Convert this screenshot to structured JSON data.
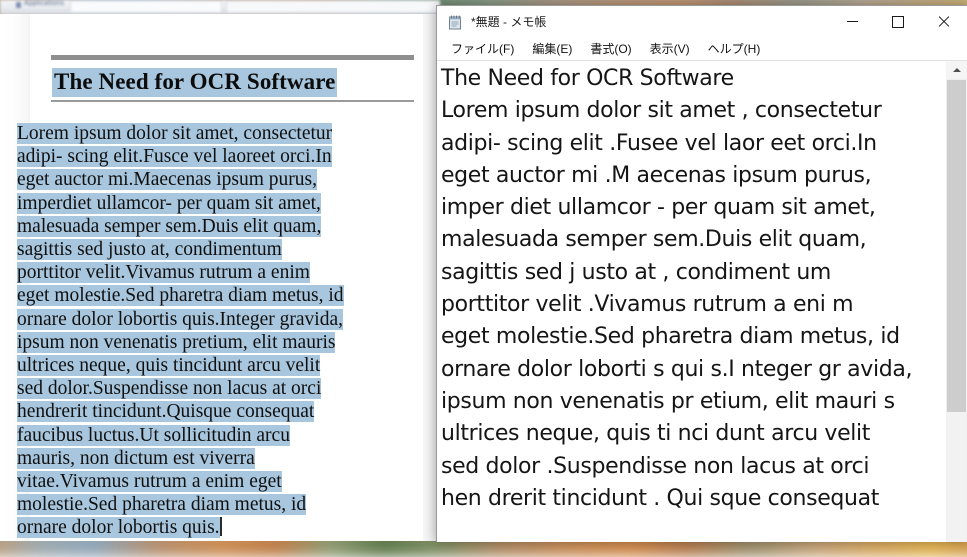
{
  "desktop": {
    "wallpaper_description": "blurred canyon landscape",
    "wallpaper_colors": [
      "#b98a63",
      "#8fa6b8",
      "#5f7a4b",
      "#d6a75e"
    ]
  },
  "background_window": {
    "tab_label": "Applications",
    "icon": "person-icon"
  },
  "document_pane": {
    "title": "The Need for OCR Software",
    "selection_color": "#a8c6dd",
    "body_lines": [
      "Lorem ipsum dolor sit amet, consectetur",
      "adipi- scing elit.Fusce vel laoreet orci.In",
      "eget auctor mi.Maecenas ipsum purus,",
      "imperdiet ullamcor- per quam sit amet,",
      "malesuada semper sem.Duis elit quam,",
      "sagittis sed justo at, condimentum",
      "porttitor velit.Vivamus rutrum a enim",
      "eget molestie.Sed pharetra diam metus, id",
      "ornare dolor lobortis quis.Integer gravida,",
      "ipsum non venenatis pretium, elit mauris",
      "ultrices neque, quis tincidunt arcu velit",
      "sed dolor.Suspendisse non lacus at orci",
      "hendrerit tincidunt.Quisque consequat",
      "faucibus luctus.Ut sollicitudin arcu",
      "mauris, non dictum est viverra",
      "vitae.Vivamus rutrum a enim eget",
      "molestie.Sed pharetra diam metus, id",
      "ornare dolor lobortis quis."
    ]
  },
  "notepad": {
    "icon": "notepad-icon",
    "title": "*無題 - メモ帳",
    "menu": [
      {
        "label": "ファイル(F)",
        "name": "menu-file"
      },
      {
        "label": "編集(E)",
        "name": "menu-edit"
      },
      {
        "label": "書式(O)",
        "name": "menu-format"
      },
      {
        "label": "表示(V)",
        "name": "menu-view"
      },
      {
        "label": "ヘルプ(H)",
        "name": "menu-help"
      }
    ],
    "window_controls": {
      "minimize": "minimize-icon",
      "maximize": "maximize-icon",
      "close": "close-icon"
    },
    "text_lines": [
      "The Need for OCR Software",
      "Lorem ipsum dolor sit amet , consectetur",
      "adipi- scing elit .Fusee vel laor eet orci.In",
      "eget auctor mi .M aecenas ipsum purus,",
      "imper diet ullamcor - per quam sit amet,",
      "malesuada semper sem.Duis elit quam,",
      "sagittis sed j usto at , condiment um",
      "porttitor velit .Vivamus rutrum a eni m",
      "eget molestie.Sed pharetra diam metus, id",
      "ornare dolor loborti s qui s.I nteger gr avida,",
      "ipsum non venenatis pr etium, elit mauri s",
      "ultrices neque, quis ti nci dunt arcu velit",
      "sed dolor .Suspendisse non lacus at orci",
      "hen drerit tincidunt . Qui sque consequat"
    ],
    "scrollbar": {
      "up_arrow": "chevron-up-icon",
      "thumb_position": "top"
    }
  }
}
